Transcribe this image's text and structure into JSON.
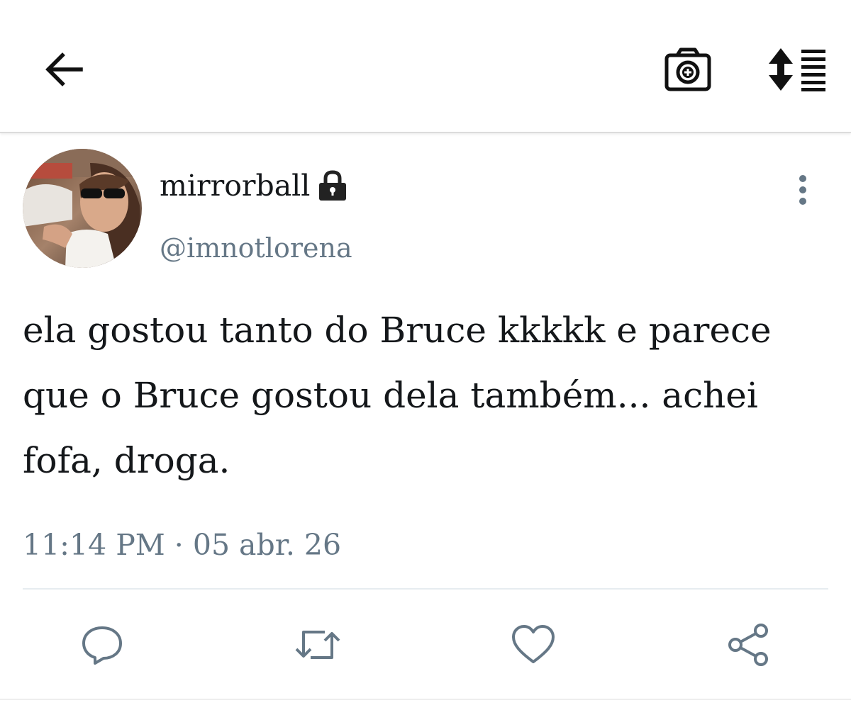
{
  "header": {
    "back_icon": "arrow-left-icon",
    "camera_icon": "camera-plus-icon",
    "sort_icon": "sort-lines-icon"
  },
  "tweet": {
    "avatar_icon": "profile-photo",
    "display_name": "mirrorball",
    "protected_icon": "lock-icon",
    "handle": "@imnotlorena",
    "more_icon": "vertical-dots-icon",
    "text": "ela gostou tanto do Bruce kkkkk e parece que o Bruce gostou dela também... achei fofa, droga.",
    "timestamp": "11:14 PM · 05 abr. 26"
  },
  "actions": {
    "reply_icon": "speech-bubble-icon",
    "retweet_icon": "retweet-icon",
    "like_icon": "heart-icon",
    "share_icon": "share-icon"
  },
  "colors": {
    "text": "#14171a",
    "secondary_text": "#657786",
    "action_icons": "#657786",
    "divider": "#e6ecf0"
  }
}
